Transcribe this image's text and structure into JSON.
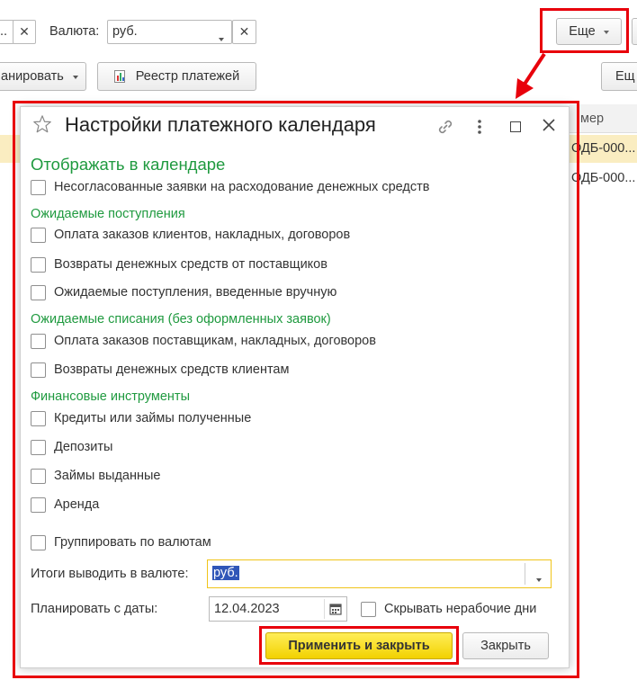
{
  "toolbar": {
    "left_field_partial": "...",
    "currency_label": "Валюта:",
    "currency_value": "руб.",
    "more_button": "Еще",
    "plan_button_partial": "анировать",
    "registry_button": "Реестр платежей",
    "more_button_2": "Ещ"
  },
  "table": {
    "col_header_partial": "мер",
    "rows": [
      "ОДБ-000...",
      "ОДБ-000..."
    ]
  },
  "dialog": {
    "title": "Настройки платежного календаря",
    "show_heading": "Отображать в календаре",
    "unapproved": "Несогласованные заявки на расходование денежных средств",
    "expected_income_heading": "Ожидаемые поступления",
    "income_items": [
      "Оплата заказов клиентов, накладных, договоров",
      "Возвраты денежных средств от поставщиков",
      "Ожидаемые поступления, введенные вручную"
    ],
    "expected_outflow_heading": "Ожидаемые списания (без оформленных заявок)",
    "outflow_items": [
      "Оплата заказов поставщикам, накладных, договоров",
      "Возвраты денежных средств клиентам"
    ],
    "financial_heading": "Финансовые инструменты",
    "financial_items": [
      "Кредиты или займы полученные",
      "Депозиты",
      "Займы выданные",
      "Аренда"
    ],
    "group_by_currency": "Группировать по валютам",
    "totals_label": "Итоги выводить в валюте:",
    "totals_value": "руб.",
    "plan_from_label": "Планировать с даты:",
    "plan_from_value": "12.04.2023",
    "hide_nonworking": "Скрывать нерабочие дни",
    "apply_button": "Применить и закрыть",
    "close_button": "Закрыть"
  },
  "colors": {
    "highlight_red": "#e8000b",
    "section_green": "#1f9a3f",
    "accent_yellow": "#f7dd1a",
    "selection_blue": "#2f56b8",
    "focus_border": "#f0c419"
  }
}
